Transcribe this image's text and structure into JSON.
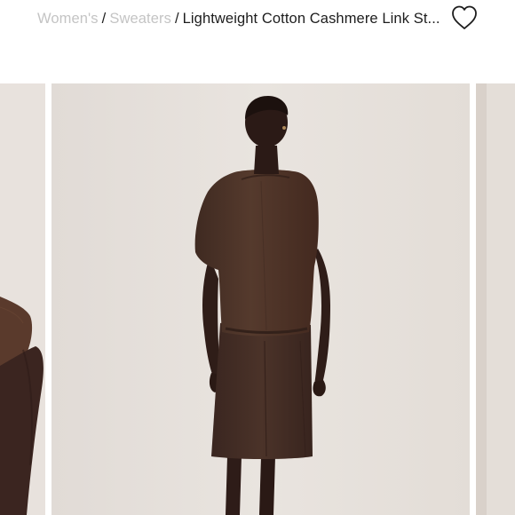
{
  "breadcrumb": {
    "items": [
      {
        "label": "Women's"
      },
      {
        "label": "Sweaters"
      }
    ],
    "separator": "/",
    "current": "Lightweight Cotton Cashmere Link St..."
  },
  "wishlist": {
    "icon": "heart-outline-icon"
  },
  "gallery": {
    "slides": [
      {
        "position": "previous",
        "subject": "partial view of brown knit sleeve"
      },
      {
        "position": "current",
        "subject": "model in brown lightweight sweater and skirt, back view"
      },
      {
        "position": "next",
        "subject": "partial view of next product image"
      }
    ]
  },
  "colors": {
    "breadcrumb_link": "#c4c4c4",
    "text": "#1d1d1d",
    "photo_background": "#e6e1dc",
    "garment": "#4a3328"
  }
}
